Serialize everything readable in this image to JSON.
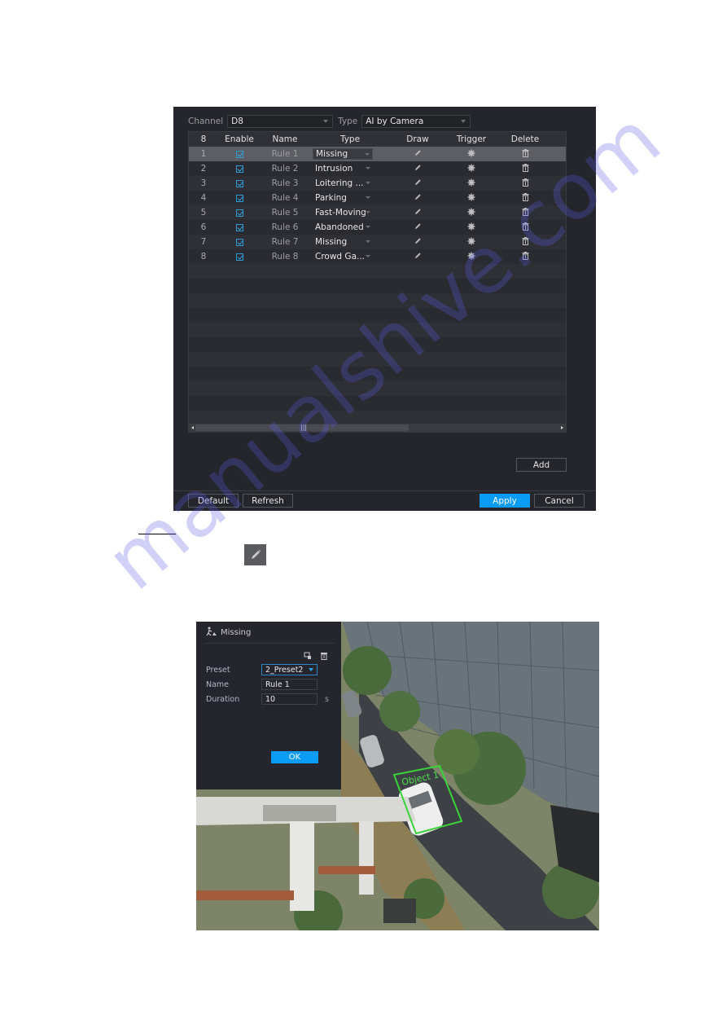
{
  "rules_panel": {
    "filter": {
      "channel_label": "Channel",
      "channel_value": "D8",
      "type_label": "Type",
      "type_value": "AI by Camera"
    },
    "table": {
      "headers": {
        "count": "8",
        "enable": "Enable",
        "name": "Name",
        "type": "Type",
        "draw": "Draw",
        "trigger": "Trigger",
        "delete": "Delete"
      },
      "rows": [
        {
          "num": "1",
          "enabled": true,
          "name": "Rule 1",
          "type": "Missing",
          "selected": true
        },
        {
          "num": "2",
          "enabled": true,
          "name": "Rule 2",
          "type": "Intrusion",
          "selected": false
        },
        {
          "num": "3",
          "enabled": true,
          "name": "Rule 3",
          "type": "Loitering ...",
          "selected": false
        },
        {
          "num": "4",
          "enabled": true,
          "name": "Rule 4",
          "type": "Parking",
          "selected": false
        },
        {
          "num": "5",
          "enabled": true,
          "name": "Rule 5",
          "type": "Fast-Moving",
          "selected": false
        },
        {
          "num": "6",
          "enabled": true,
          "name": "Rule 6",
          "type": "Abandoned",
          "selected": false
        },
        {
          "num": "7",
          "enabled": true,
          "name": "Rule 7",
          "type": "Missing",
          "selected": false
        },
        {
          "num": "8",
          "enabled": true,
          "name": "Rule 8",
          "type": "Crowd Ga...",
          "selected": false
        }
      ],
      "icons": {
        "draw": "pencil-icon",
        "trigger": "gear-icon",
        "delete": "trash-icon"
      }
    },
    "buttons": {
      "add": "Add",
      "default": "Default",
      "refresh": "Refresh",
      "apply": "Apply",
      "cancel": "Cancel"
    },
    "colors": {
      "accent": "#0a9bf7",
      "panel_bg": "#25262b",
      "selected_row": "#5d5e63"
    }
  },
  "inline_icon": "pencil-icon",
  "camera_view": {
    "dialog": {
      "title": "Missing",
      "title_icon": "person-object-icon",
      "toolbar_icons": [
        "draw-area-icon",
        "trash-icon"
      ],
      "fields": {
        "preset_label": "Preset",
        "preset_value": "2_Preset2",
        "name_label": "Name",
        "name_value": "Rule 1",
        "duration_label": "Duration",
        "duration_value": "10",
        "duration_unit": "s"
      },
      "ok_label": "OK"
    },
    "detection": {
      "label": "Object 1",
      "color": "#3ad33a"
    }
  },
  "watermark": "manualshive.com"
}
